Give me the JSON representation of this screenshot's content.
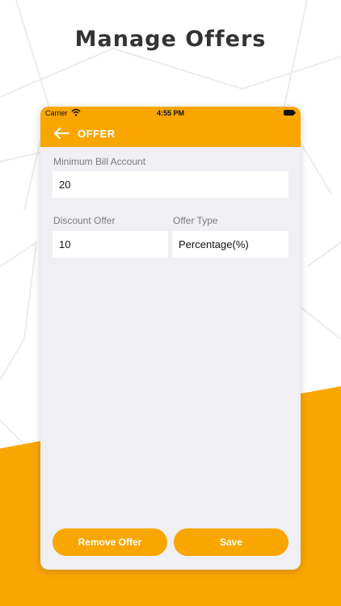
{
  "headline": "Manage Offers",
  "status_bar": {
    "carrier": "Carrier",
    "time": "4:55 PM",
    "wifi_icon": "wifi-icon",
    "battery_icon": "battery-icon"
  },
  "nav": {
    "back_icon": "arrow-left-icon",
    "title": "OFFER"
  },
  "form": {
    "min_bill": {
      "label": "Minimum Bill Account",
      "value": "20"
    },
    "discount": {
      "label": "Discount Offer",
      "value": "10"
    },
    "offer_type": {
      "label": "Offer Type",
      "value": "Percentage(%)"
    }
  },
  "buttons": {
    "remove": "Remove Offer",
    "save": "Save"
  },
  "colors": {
    "accent": "#f9a600",
    "form_background": "#efeff4",
    "headline": "#333333"
  }
}
